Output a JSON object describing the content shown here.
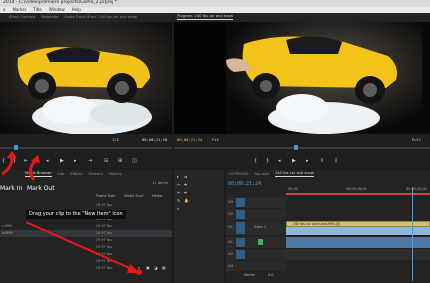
{
  "window": {
    "title": "2014 - C:\\video\\premiere projects\\GoPro_2.prproj *"
  },
  "menu": [
    "e",
    "Marker",
    "Title",
    "Window",
    "Help"
  ],
  "source_panel": {
    "tabs": [
      "",
      "Effect Controls",
      "Metadata",
      "Audio Track Mixer: 240 fps car and snow"
    ],
    "timecode_right": "00;00;11;18",
    "zoom": "1/2"
  },
  "program_panel": {
    "tab": "Program: 240 fps car and snow",
    "timecode": "00;00;21;24",
    "fit": "Fit",
    "full": "Full"
  },
  "project_panel": {
    "tabs": [
      "Media Browser",
      "Info",
      "Effects",
      "Markers",
      "History"
    ],
    "items_count": "11 Items",
    "columns": [
      "Frame Rate",
      "Media Start",
      "Media"
    ],
    "rows": [
      {
        "name": "",
        "rate": "29.97 fps",
        "start": "",
        "end": ""
      },
      {
        "name": "",
        "rate": "29.97 fps",
        "start": "",
        "end": ""
      },
      {
        "name": "",
        "rate": "29.97 fps",
        "start": "",
        "end": ""
      },
      {
        "name": "c.MP4",
        "rate": "29.97 fps",
        "start": "",
        "end": ""
      },
      {
        "name": "w.MP4",
        "rate": "29.97 fps",
        "start": "",
        "end": ""
      },
      {
        "name": "",
        "rate": "29.97 fps",
        "start": "",
        "end": ""
      },
      {
        "name": "",
        "rate": "29.97 fps",
        "start": "",
        "end": ""
      },
      {
        "name": "",
        "rate": "29.97 fps",
        "start": "",
        "end": ""
      },
      {
        "name": "",
        "rate": "29.97 fps",
        "start": "",
        "end": ""
      },
      {
        "name": "",
        "rate": "29.97 fps",
        "start": "",
        "end": ""
      }
    ]
  },
  "timeline": {
    "tabs": [
      "GOPR0000",
      "fog opts",
      "240 fps car and snow"
    ],
    "timecode": "00;00;21;24",
    "ruler": [
      "00;00",
      "00;00;16;00",
      "00;00;32;00"
    ],
    "video_tracks": [
      "V3",
      "V2",
      "V1"
    ],
    "audio_tracks": [
      "A1",
      "A2",
      "A3"
    ],
    "master": "Master",
    "master_value": "0.0",
    "clip_name": "240 fps car and snow.MP4 [V]",
    "track_label": "Video 1"
  },
  "annotations": {
    "mark_in": "Mark In",
    "mark_out": "Mark Out",
    "drag_hint": "Drag your clip to the \"New Item\" icon"
  },
  "colors": {
    "accent_blue": "#3f9fe6",
    "arrow_red": "#e81616",
    "playhead_red": "#e23a3a"
  }
}
